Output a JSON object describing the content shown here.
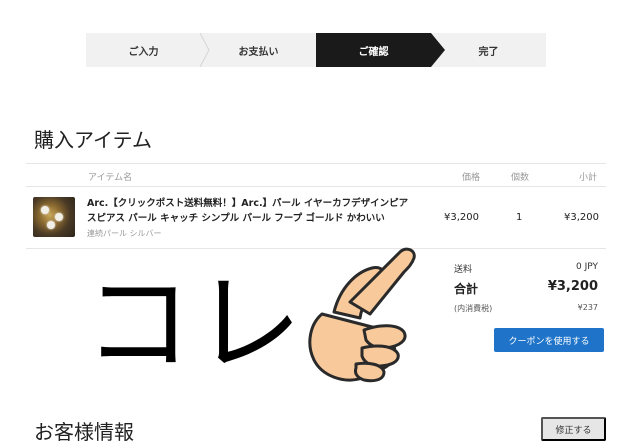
{
  "steps": [
    {
      "label": "ご入力"
    },
    {
      "label": "お支払い"
    },
    {
      "label": "ご確認"
    },
    {
      "label": "完了"
    }
  ],
  "purchase": {
    "title": "購入アイテム",
    "columns": {
      "item": "アイテム名",
      "price": "価格",
      "qty": "個数",
      "subtotal": "小計"
    },
    "item": {
      "name": "Arc.【クリックポスト送料無料！】Arc.】パール イヤーカフデザインピアスピアス パール キャッチ シンプル パール フープ ゴールド かわいい",
      "variant": "連続パール シルバー",
      "price": "¥3,200",
      "qty": "1",
      "subtotal": "¥3,200"
    },
    "summary": {
      "shipping_label": "送料",
      "shipping_value": "0 JPY",
      "total_label": "合計",
      "total_value": "¥3,200",
      "tax_label": "(内消費税)",
      "tax_value": "¥237"
    },
    "coupon_button": "クーポンを使用する"
  },
  "customer": {
    "title": "お客様情報",
    "edit_button": "修正する"
  },
  "annotation": {
    "text": "コレ"
  },
  "colors": {
    "accent": "#1f74c9",
    "active_step": "#1a1a1a",
    "hand_fill": "#f7c99b",
    "hand_stroke": "#2a2a2a"
  }
}
